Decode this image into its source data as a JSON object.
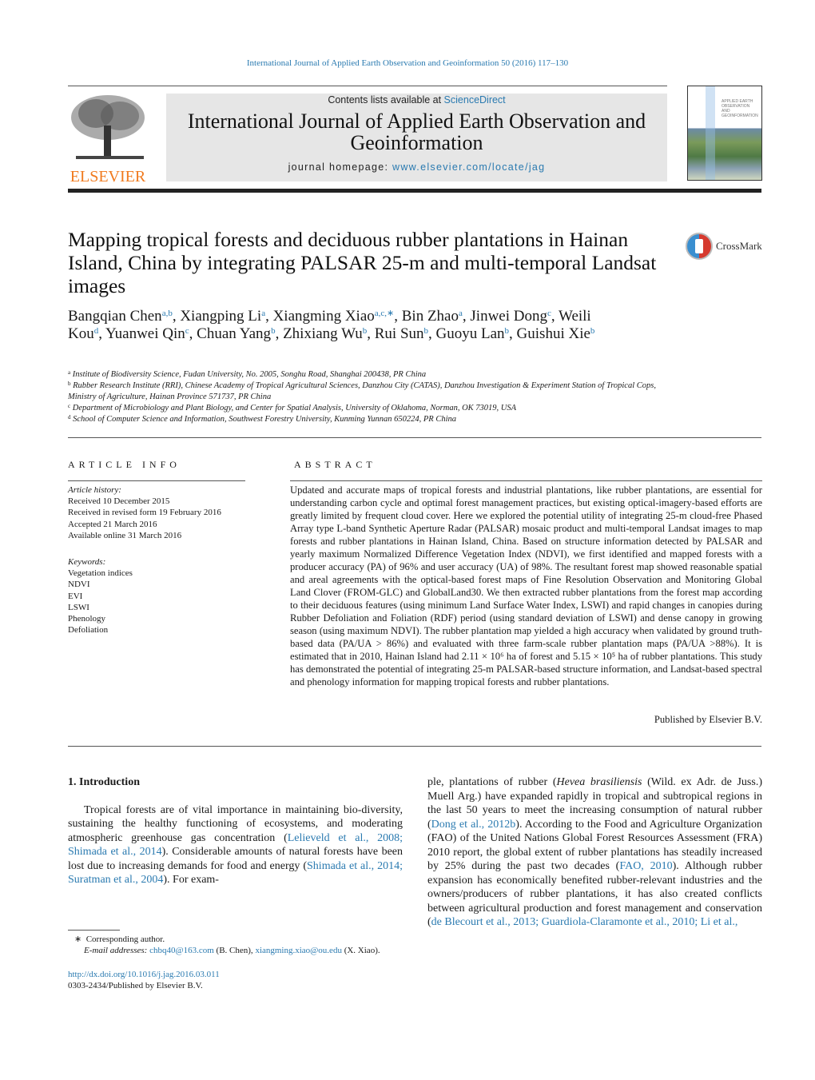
{
  "journal_ref": "International Journal of Applied Earth Observation and Geoinformation 50 (2016) 117–130",
  "header": {
    "publisher_logo_text": "ELSEVIER",
    "contents_prefix": "Contents lists available at ",
    "contents_link": "ScienceDirect",
    "journal_title": "International Journal of Applied Earth Observation and Geoinformation",
    "homepage_prefix": "journal homepage: ",
    "homepage_link": "www.elsevier.com/locate/jag",
    "cover_text": "APPLIED EARTH OBSERVATION AND GEOINFORMATION"
  },
  "article": {
    "title": "Mapping tropical forests and deciduous rubber plantations in Hainan Island, China by integrating PALSAR 25-m and multi-temporal Landsat images",
    "crossmark": "CrossMark",
    "authors": [
      {
        "name": "Bangqian Chen",
        "aff": "a,b",
        "sep": ", "
      },
      {
        "name": "Xiangping Li",
        "aff": "a",
        "sep": ", "
      },
      {
        "name": "Xiangming Xiao",
        "aff": "a,c,∗",
        "sep": ", "
      },
      {
        "name": "Bin Zhao",
        "aff": "a",
        "sep": ", "
      },
      {
        "name": "Jinwei Dong",
        "aff": "c",
        "sep": ", "
      },
      {
        "name": "Weili Kou",
        "aff": "d",
        "sep": ", "
      },
      {
        "name": "Yuanwei Qin",
        "aff": "c",
        "sep": ", "
      },
      {
        "name": "Chuan Yang",
        "aff": "b",
        "sep": ", "
      },
      {
        "name": "Zhixiang Wu",
        "aff": "b",
        "sep": ", "
      },
      {
        "name": "Rui Sun",
        "aff": "b",
        "sep": ", "
      },
      {
        "name": "Guoyu Lan",
        "aff": "b",
        "sep": ", "
      },
      {
        "name": "Guishui Xie",
        "aff": "b",
        "sep": ""
      }
    ],
    "affiliations": [
      {
        "key": "a",
        "text": "Institute of Biodiversity Science, Fudan University, No. 2005, Songhu Road, Shanghai 200438, PR China"
      },
      {
        "key": "b",
        "text": "Rubber Research Institute (RRI), Chinese Academy of Tropical Agricultural Sciences, Danzhou City (CATAS), Danzhou Investigation & Experiment Station of Tropical Cops, Ministry of Agriculture, Hainan Province 571737, PR China"
      },
      {
        "key": "c",
        "text": "Department of Microbiology and Plant Biology, and Center for Spatial Analysis, University of Oklahoma, Norman, OK 73019, USA"
      },
      {
        "key": "d",
        "text": "School of Computer Science and Information, Southwest Forestry University, Kunming Yunnan 650224, PR China"
      }
    ]
  },
  "article_info": {
    "heading": "ARTICLE INFO",
    "history_label": "Article history:",
    "history": [
      "Received 10 December 2015",
      "Received in revised form 19 February 2016",
      "Accepted 21 March 2016",
      "Available online 31 March 2016"
    ],
    "keywords_label": "Keywords:",
    "keywords": [
      "Vegetation indices",
      "NDVI",
      "EVI",
      "LSWI",
      "Phenology",
      "Defoliation"
    ]
  },
  "abstract": {
    "heading": "ABSTRACT",
    "text": "Updated and accurate maps of tropical forests and industrial plantations, like rubber plantations, are essential for understanding carbon cycle and optimal forest management practices, but existing optical-imagery-based efforts are greatly limited by frequent cloud cover. Here we explored the potential utility of integrating 25-m cloud-free Phased Array type L-band Synthetic Aperture Radar (PALSAR) mosaic product and multi-temporal Landsat images to map forests and rubber plantations in Hainan Island, China. Based on structure information detected by PALSAR and yearly maximum Normalized Difference Vegetation Index (NDVI), we first identified and mapped forests with a producer accuracy (PA) of 96% and user accuracy (UA) of 98%. The resultant forest map showed reasonable spatial and areal agreements with the optical-based forest maps of Fine Resolution Observation and Monitoring Global Land Clover (FROM-GLC) and GlobalLand30. We then extracted rubber plantations from the forest map according to their deciduous features (using minimum Land Surface Water Index, LSWI) and rapid changes in canopies during Rubber Defoliation and Foliation (RDF) period (using standard deviation of LSWI) and dense canopy in growing season (using maximum NDVI). The rubber plantation map yielded a high accuracy when validated by ground truth-based data (PA/UA > 86%) and evaluated with three farm-scale rubber plantation maps (PA/UA >88%). It is estimated that in 2010, Hainan Island had 2.11 × 10⁶ ha of forest and 5.15 × 10⁵ ha of rubber plantations. This study has demonstrated the potential of integrating 25-m PALSAR-based structure information, and Landsat-based spectral and phenology information for mapping tropical forests and rubber plantations.",
    "published_by": "Published by Elsevier B.V."
  },
  "intro": {
    "heading": "1.  Introduction",
    "col1": [
      {
        "t": "Tropical forests are of vital importance in maintaining bio-diversity, sustaining the healthy functioning of ecosystems, and moderating atmospheric greenhouse gas concentration ("
      },
      {
        "t": "Lelieveld et al., 2008; Shimada et al., 2014",
        "link": true
      },
      {
        "t": "). Considerable amounts of natural forests have been lost due to increasing demands for food and energy ("
      },
      {
        "t": "Shimada et al., 2014; Suratman et al., 2004",
        "link": true
      },
      {
        "t": "). For exam-"
      }
    ],
    "col2": [
      {
        "t": "ple, plantations of rubber ("
      },
      {
        "t": "Hevea brasiliensis",
        "italic": true
      },
      {
        "t": " (Wild. ex Adr. de Juss.) Muell Arg.) have expanded rapidly in tropical and subtropical regions in the last 50 years to meet the increasing consumption of natural rubber ("
      },
      {
        "t": "Dong et al., 2012b",
        "link": true
      },
      {
        "t": "). According to the Food and Agriculture Organization (FAO) of the United Nations Global Forest Resources Assessment (FRA) 2010 report, the global extent of rubber plantations has steadily increased by 25% during the past two decades ("
      },
      {
        "t": "FAO, 2010",
        "link": true
      },
      {
        "t": "). Although rubber expansion has economically benefited rubber-relevant industries and the owners/producers of rubber plantations, it has also created conflicts between agricultural production and forest management and conservation ("
      },
      {
        "t": "de Blecourt et al., 2013; Guardiola-Claramonte et al., 2010; Li et al.,",
        "link": true
      }
    ]
  },
  "footnote": {
    "star": "∗",
    "corresponding": "Corresponding author.",
    "email_label": "E-mail addresses:",
    "email1": "chbq40@163.com",
    "email1_who": " (B. Chen), ",
    "email2": "xiangming.xiao@ou.edu",
    "email2_who": " (X. Xiao)."
  },
  "doi": "http://dx.doi.org/10.1016/j.jag.2016.03.011",
  "issn": "0303-2434/Published by Elsevier B.V.",
  "colors": {
    "link": "#2a7ab0",
    "elsevier": "#f07a1e",
    "header_box": "#e6e6e6"
  }
}
